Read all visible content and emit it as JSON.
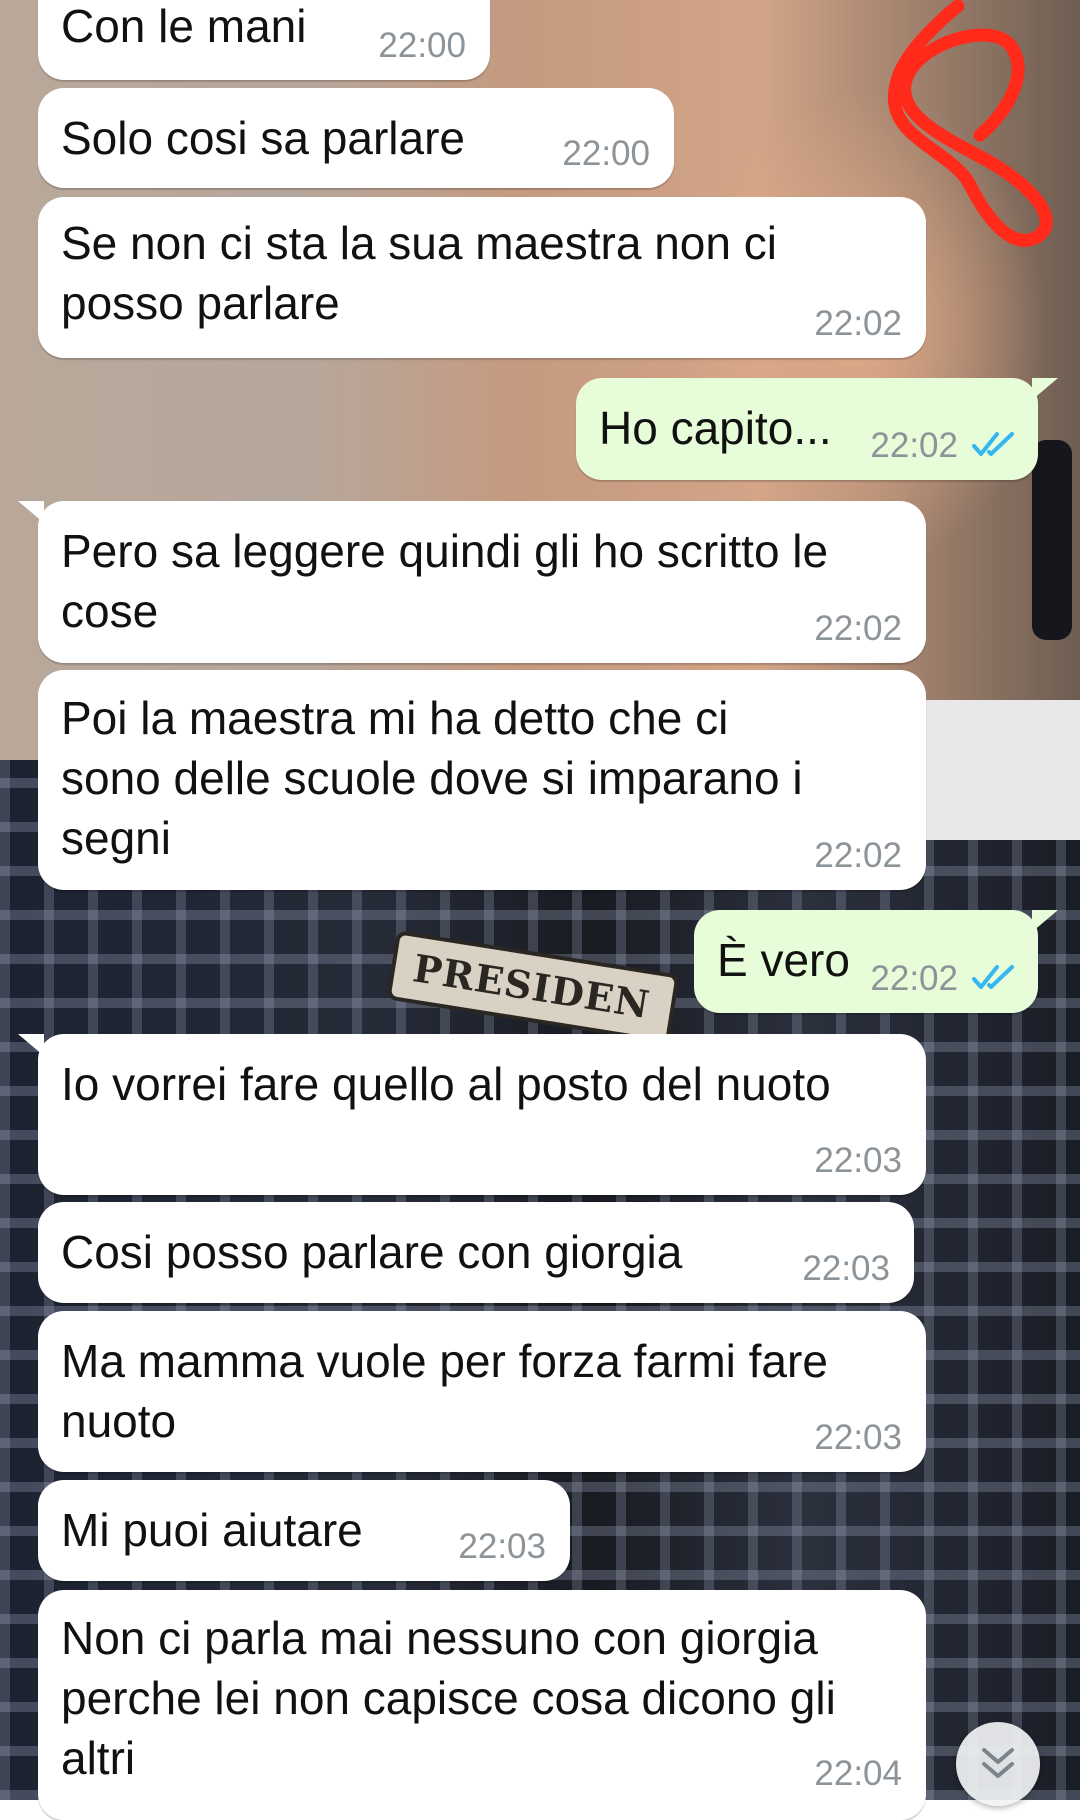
{
  "wallpaper": {
    "patch_text": "PRESIDEN"
  },
  "colors": {
    "incoming_bubble": "#ffffff",
    "outgoing_bubble": "#e7fcd8",
    "timestamp": "#8d9499",
    "read_ticks": "#34b7f1",
    "annotation_scribble": "#ff2a1a"
  },
  "messages": [
    {
      "direction": "in",
      "lines": [
        "Con le mani"
      ],
      "time": "22:00"
    },
    {
      "direction": "in",
      "lines": [
        "Solo cosi sa parlare"
      ],
      "time": "22:00"
    },
    {
      "direction": "in",
      "lines": [
        "Se non ci sta la sua maestra non ci",
        "posso parlare"
      ],
      "time": "22:02"
    },
    {
      "direction": "out",
      "lines": [
        "Ho capito..."
      ],
      "time": "22:02",
      "status": "read-double-tick-icon"
    },
    {
      "direction": "in",
      "lines": [
        "Pero sa leggere quindi gli ho scritto le",
        "cose"
      ],
      "time": "22:02"
    },
    {
      "direction": "in",
      "lines": [
        "Poi la maestra mi ha detto che ci",
        "sono delle scuole dove si imparano i",
        "segni"
      ],
      "time": "22:02"
    },
    {
      "direction": "out",
      "lines": [
        "È vero"
      ],
      "time": "22:02",
      "status": "read-double-tick-icon"
    },
    {
      "direction": "in",
      "lines": [
        "Io vorrei fare quello al posto del nuoto"
      ],
      "time": "22:03"
    },
    {
      "direction": "in",
      "lines": [
        "Cosi posso parlare con giorgia"
      ],
      "time": "22:03"
    },
    {
      "direction": "in",
      "lines": [
        "Ma mamma vuole per forza farmi fare",
        "nuoto"
      ],
      "time": "22:03"
    },
    {
      "direction": "in",
      "lines": [
        "Mi puoi aiutare"
      ],
      "time": "22:03"
    },
    {
      "direction": "in",
      "lines": [
        "Non ci parla mai nessuno con giorgia",
        "perche lei non capisce cosa dicono gli",
        "altri"
      ],
      "time": "22:04"
    }
  ],
  "scroll_button": {
    "icon": "double-chevron-down-icon"
  }
}
